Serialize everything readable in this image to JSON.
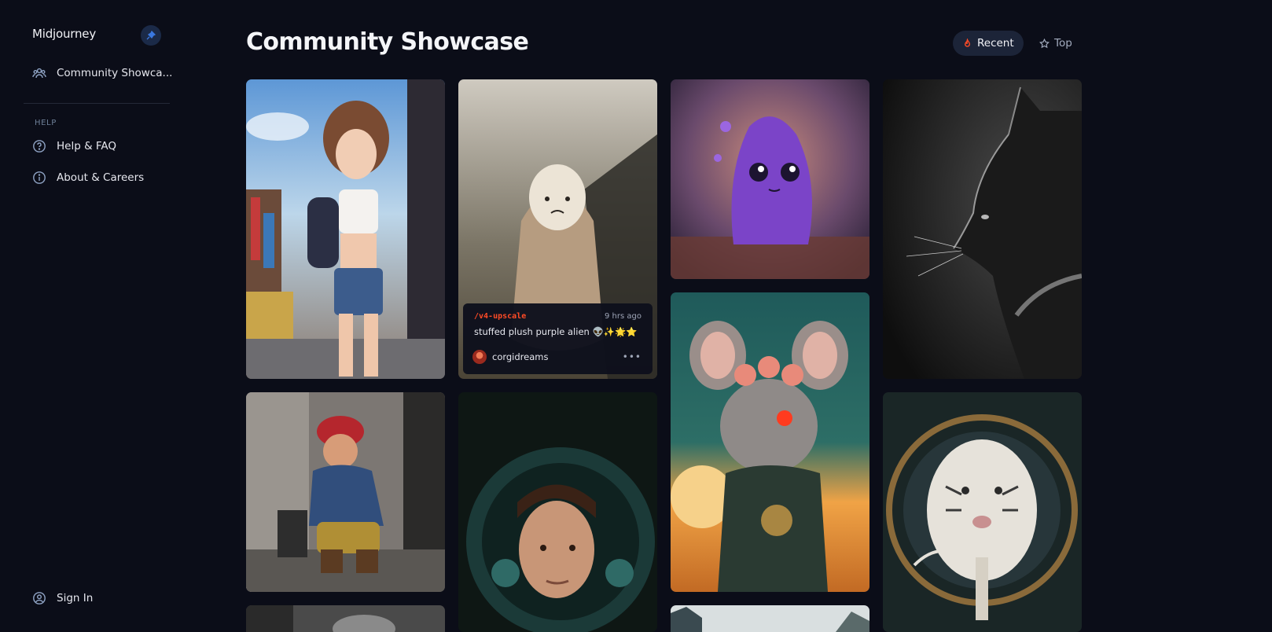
{
  "sidebar": {
    "brand": "Midjourney",
    "nav": [
      {
        "label": "Community Showca..."
      }
    ],
    "help_section_label": "HELP",
    "help_items": [
      {
        "label": "Help & FAQ"
      },
      {
        "label": "About & Careers"
      }
    ],
    "sign_in_label": "Sign In"
  },
  "header": {
    "title": "Community Showcase",
    "filters": [
      {
        "label": "Recent",
        "active": true
      },
      {
        "label": "Top",
        "active": false
      }
    ]
  },
  "gallery": {
    "hover_card": {
      "command": "/v4-upscale",
      "time": "9 hrs ago",
      "prompt": "stuffed plush purple alien 👽✨🌟⭐",
      "username": "corgidreams"
    },
    "images": [
      {
        "subject": "anime girl with backpack on city street"
      },
      {
        "subject": "plush figure wrapped in blanket"
      },
      {
        "subject": "purple slime alien creature"
      },
      {
        "subject": "black and white cat profile"
      },
      {
        "subject": "Mario sitting on sidewalk"
      },
      {
        "subject": "astronaut woman in helmet"
      },
      {
        "subject": "mouse warrior with flower crown at sunset"
      },
      {
        "subject": "white tiger and small figure in ornate frame"
      },
      {
        "subject": "grayscale image, partially visible"
      },
      {
        "subject": "landscape image, partially visible"
      }
    ]
  },
  "colors": {
    "background": "#0b0d18",
    "accent_red": "#ff4b26",
    "pin_blue": "#3a78e0"
  }
}
